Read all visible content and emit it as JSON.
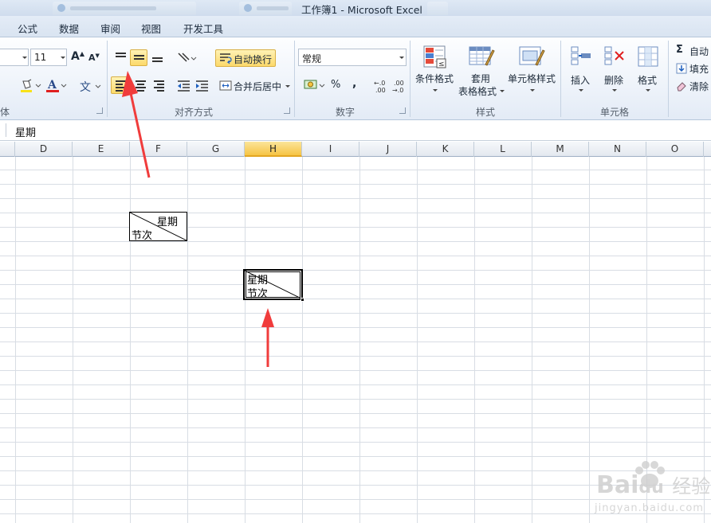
{
  "window": {
    "title": "工作簿1  -  Microsoft Excel"
  },
  "ribbon_tabs": [
    "公式",
    "数据",
    "审阅",
    "视图",
    "开发工具"
  ],
  "font_group": {
    "font_size": "11",
    "label": "体"
  },
  "alignment_group": {
    "wrap_text": "自动换行",
    "merge_center": "合并后居中",
    "label": "对齐方式"
  },
  "number_group": {
    "format": "常规",
    "percent": "%",
    "comma": ",",
    "label": "数字"
  },
  "styles_group": {
    "conditional": "条件格式",
    "table_line1": "套用",
    "table_line2": "表格格式",
    "cell_styles": "单元格样式",
    "label": "样式"
  },
  "cells_group": {
    "insert": "插入",
    "delete": "删除",
    "format": "格式",
    "label": "单元格"
  },
  "editing_group": {
    "autosum": "自动",
    "fill": "填充",
    "clear": "清除"
  },
  "formula_bar": {
    "value": "星期"
  },
  "columns": [
    "D",
    "E",
    "F",
    "G",
    "H",
    "I",
    "J",
    "K",
    "L",
    "M",
    "N",
    "O"
  ],
  "selected_column": "H",
  "cells": {
    "f_top": "星期",
    "f_bottom": "节次",
    "h_top": "星期",
    "h_bottom": "节次"
  },
  "watermark": {
    "brand": "Bai",
    "brand2": "经验",
    "url": "jingyan.baidu.com"
  },
  "colors": {
    "arrow": "#f03c3c",
    "selected_header": "#f6c445",
    "active_button": "#fcd96a"
  }
}
